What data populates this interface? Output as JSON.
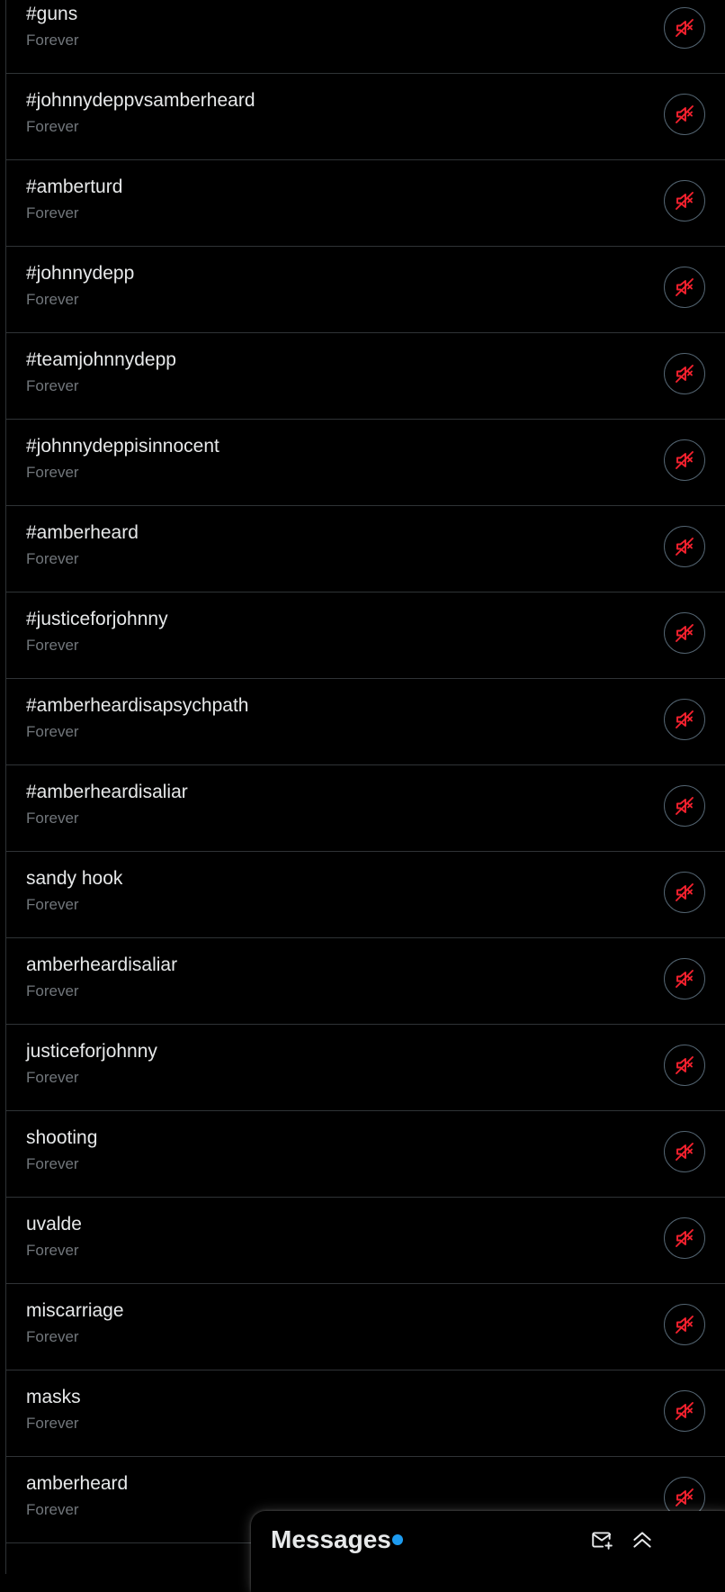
{
  "colors": {
    "background": "#000000",
    "text_primary": "#e7e9ea",
    "text_secondary": "#71767b",
    "divider": "#2f3336",
    "mute_icon": "#f4212e",
    "notification_dot": "#1d9bf0"
  },
  "muted_words": [
    {
      "word": "#guns",
      "duration": "Forever"
    },
    {
      "word": "#johnnydeppvsamberheard",
      "duration": "Forever"
    },
    {
      "word": "#amberturd",
      "duration": "Forever"
    },
    {
      "word": "#johnnydepp",
      "duration": "Forever"
    },
    {
      "word": "#teamjohnnydepp",
      "duration": "Forever"
    },
    {
      "word": "#johnnydeppisinnocent",
      "duration": "Forever"
    },
    {
      "word": "#amberheard",
      "duration": "Forever"
    },
    {
      "word": "#justiceforjohnny",
      "duration": "Forever"
    },
    {
      "word": "#amberheardisapsychpath",
      "duration": "Forever"
    },
    {
      "word": "#amberheardisaliar",
      "duration": "Forever"
    },
    {
      "word": "sandy hook",
      "duration": "Forever"
    },
    {
      "word": "amberheardisaliar",
      "duration": "Forever"
    },
    {
      "word": "justiceforjohnny",
      "duration": "Forever"
    },
    {
      "word": "shooting",
      "duration": "Forever"
    },
    {
      "word": "uvalde",
      "duration": "Forever"
    },
    {
      "word": "miscarriage",
      "duration": "Forever"
    },
    {
      "word": "masks",
      "duration": "Forever"
    },
    {
      "word": "amberheard",
      "duration": "Forever"
    }
  ],
  "row_action_icon": "speaker-muted-icon",
  "messages_drawer": {
    "title": "Messages",
    "has_unread": true,
    "new_message_icon": "envelope-plus-icon",
    "expand_icon": "double-chevron-up-icon"
  }
}
